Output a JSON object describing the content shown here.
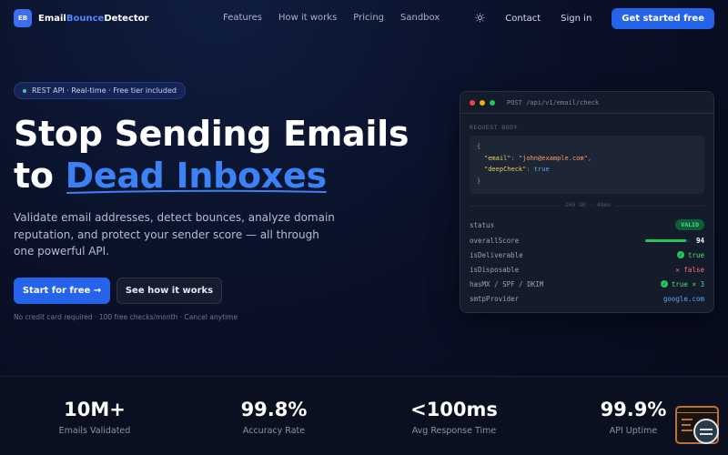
{
  "nav": {
    "logo_badge": "EB",
    "brand_part1": "Email",
    "brand_part2": "Bounce",
    "brand_part3": "Detector",
    "links": [
      "Features",
      "How it works",
      "Pricing",
      "Sandbox"
    ],
    "contact": "Contact",
    "signin": "Sign in",
    "cta": "Get started free"
  },
  "hero": {
    "pill": "REST API · Real-time · Free tier included",
    "title_line1": "Stop Sending Emails",
    "title_to": "to ",
    "title_highlight": "Dead Inboxes",
    "lede": "Validate email addresses, detect bounces, analyze domain reputation, and protect your sender score — all through one powerful API.",
    "primary": "Start for free →",
    "secondary": "See how it works",
    "fine": "No credit card required · 100 free checks/month · Cancel anytime"
  },
  "card": {
    "title": "POST /api/v1/email/check",
    "request_label": "REQUEST BODY",
    "code_open": "{",
    "key_email": "\"email\"",
    "val_email": "\"john@example.com\"",
    "key_deep": "\"deepCheck\"",
    "val_deep": "true",
    "code_close": "}",
    "response_label": "200 OK · 48ms",
    "status_label": "status",
    "status_value": "VALID",
    "score_label": "overallScore",
    "score_value": "94",
    "score_fraction": 0.94,
    "deliverable_label": "isDeliverable",
    "deliverable_value": "true",
    "disposable_label": "isDisposable",
    "disposable_value": "✕ false",
    "mx_label": "hasMX / SPF / DKIM",
    "mx_value": "true × 3",
    "smtp_label": "smtpProvider",
    "smtp_value": "google.com"
  },
  "stats": [
    {
      "value": "10M+",
      "label": "Emails Validated"
    },
    {
      "value": "99.8%",
      "label": "Accuracy Rate"
    },
    {
      "value": "<100ms",
      "label": "Avg Response Time"
    },
    {
      "value": "99.9%",
      "label": "API Uptime"
    }
  ],
  "colors": {
    "accent": "#2563eb",
    "highlight": "#3b82f6",
    "success": "#22c55e",
    "danger": "#f87171"
  }
}
